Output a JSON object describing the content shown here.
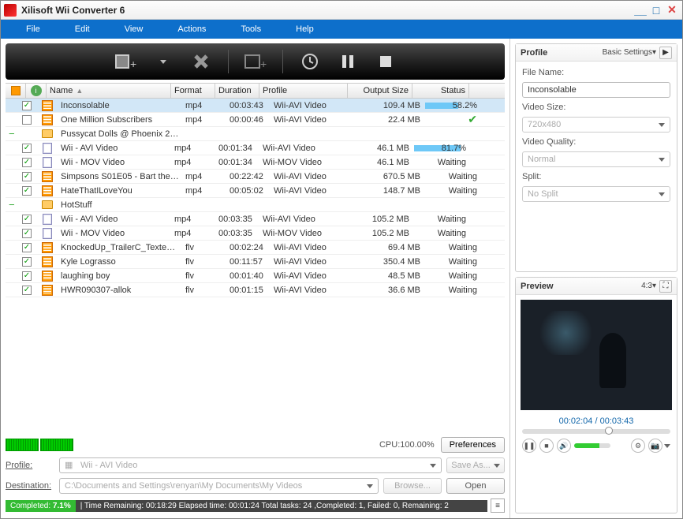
{
  "title": "Xilisoft Wii Converter 6",
  "menu": {
    "file": "File",
    "edit": "Edit",
    "view": "View",
    "actions": "Actions",
    "tools": "Tools",
    "help": "Help"
  },
  "columns": {
    "name": "Name",
    "format": "Format",
    "duration": "Duration",
    "profile": "Profile",
    "outputSize": "Output Size",
    "status": "Status"
  },
  "files": [
    {
      "indent": 0,
      "exp": "",
      "check": true,
      "icon": "film",
      "name": "Inconsolable",
      "format": "mp4",
      "duration": "00:03:43",
      "profile": "Wii-AVI Video",
      "size": "109.4 MB",
      "status": "58.2%",
      "progress": 58.2,
      "sel": true
    },
    {
      "indent": 0,
      "exp": "",
      "check": false,
      "icon": "film",
      "name": "One Million Subscribers",
      "format": "mp4",
      "duration": "00:00:46",
      "profile": "Wii-AVI Video",
      "size": "22.4 MB",
      "status": "done"
    },
    {
      "indent": 0,
      "exp": "−",
      "check": null,
      "icon": "folder",
      "name": "Pussycat Dolls @ Phoenix 24....",
      "format": "",
      "duration": "",
      "profile": "",
      "size": "",
      "status": ""
    },
    {
      "indent": 1,
      "exp": "",
      "check": true,
      "icon": "list",
      "name": "Wii - AVI Video",
      "format": "mp4",
      "duration": "00:01:34",
      "profile": "Wii-AVI Video",
      "size": "46.1 MB",
      "status": "81.7%",
      "progress": 81.7
    },
    {
      "indent": 1,
      "exp": "",
      "check": true,
      "icon": "list",
      "name": "Wii - MOV Video",
      "format": "mp4",
      "duration": "00:01:34",
      "profile": "Wii-MOV Video",
      "size": "46.1 MB",
      "status": "Waiting"
    },
    {
      "indent": 0,
      "exp": "",
      "check": true,
      "icon": "film",
      "name": "Simpsons S01E05 - Bart the G...",
      "format": "mp4",
      "duration": "00:22:42",
      "profile": "Wii-AVI Video",
      "size": "670.5 MB",
      "status": "Waiting"
    },
    {
      "indent": 0,
      "exp": "",
      "check": true,
      "icon": "film",
      "name": "HateThatILoveYou",
      "format": "mp4",
      "duration": "00:05:02",
      "profile": "Wii-AVI Video",
      "size": "148.7 MB",
      "status": "Waiting"
    },
    {
      "indent": 0,
      "exp": "−",
      "check": null,
      "icon": "folder",
      "name": "HotStuff",
      "format": "",
      "duration": "",
      "profile": "",
      "size": "",
      "status": ""
    },
    {
      "indent": 1,
      "exp": "",
      "check": true,
      "icon": "list",
      "name": "Wii - AVI Video",
      "format": "mp4",
      "duration": "00:03:35",
      "profile": "Wii-AVI Video",
      "size": "105.2 MB",
      "status": "Waiting"
    },
    {
      "indent": 1,
      "exp": "",
      "check": true,
      "icon": "list",
      "name": "Wii - MOV Video",
      "format": "mp4",
      "duration": "00:03:35",
      "profile": "Wii-MOV Video",
      "size": "105.2 MB",
      "status": "Waiting"
    },
    {
      "indent": 0,
      "exp": "",
      "check": true,
      "icon": "film",
      "name": "KnockedUp_TrailerC_Texted_...",
      "format": "flv",
      "duration": "00:02:24",
      "profile": "Wii-AVI Video",
      "size": "69.4 MB",
      "status": "Waiting"
    },
    {
      "indent": 0,
      "exp": "",
      "check": true,
      "icon": "film",
      "name": "Kyle Lograsso",
      "format": "flv",
      "duration": "00:11:57",
      "profile": "Wii-AVI Video",
      "size": "350.4 MB",
      "status": "Waiting"
    },
    {
      "indent": 0,
      "exp": "",
      "check": true,
      "icon": "film",
      "name": "laughing boy",
      "format": "flv",
      "duration": "00:01:40",
      "profile": "Wii-AVI Video",
      "size": "48.5 MB",
      "status": "Waiting"
    },
    {
      "indent": 0,
      "exp": "",
      "check": true,
      "icon": "film",
      "name": "HWR090307-allok",
      "format": "flv",
      "duration": "00:01:15",
      "profile": "Wii-AVI Video",
      "size": "36.6 MB",
      "status": "Waiting"
    }
  ],
  "cpu": "CPU:100.00%",
  "preferences": "Preferences",
  "footer": {
    "profileLbl": "Profile:",
    "profileVal": "Wii - AVI Video",
    "saveAs": "Save As...",
    "destLbl": "Destination:",
    "destVal": "C:\\Documents and Settings\\renyan\\My Documents\\My Videos",
    "browse": "Browse...",
    "open": "Open"
  },
  "statusbar": {
    "completedLbl": "Completed:",
    "completedPct": "7.1%",
    "rest": "Time Remaining: 00:18:29 Elapsed time: 00:01:24 Total tasks: 24 ,Completed: 1, Failed: 0, Remaining: 2"
  },
  "profilePanel": {
    "title": "Profile",
    "basic": "Basic Settings",
    "fileNameLbl": "File Name:",
    "fileName": "Inconsolable",
    "videoSizeLbl": "Video Size:",
    "videoSize": "720x480",
    "videoQualityLbl": "Video Quality:",
    "videoQuality": "Normal",
    "splitLbl": "Split:",
    "split": "No Split"
  },
  "previewPanel": {
    "title": "Preview",
    "aspect": "4:3",
    "time": "00:02:04 / 00:03:43"
  }
}
